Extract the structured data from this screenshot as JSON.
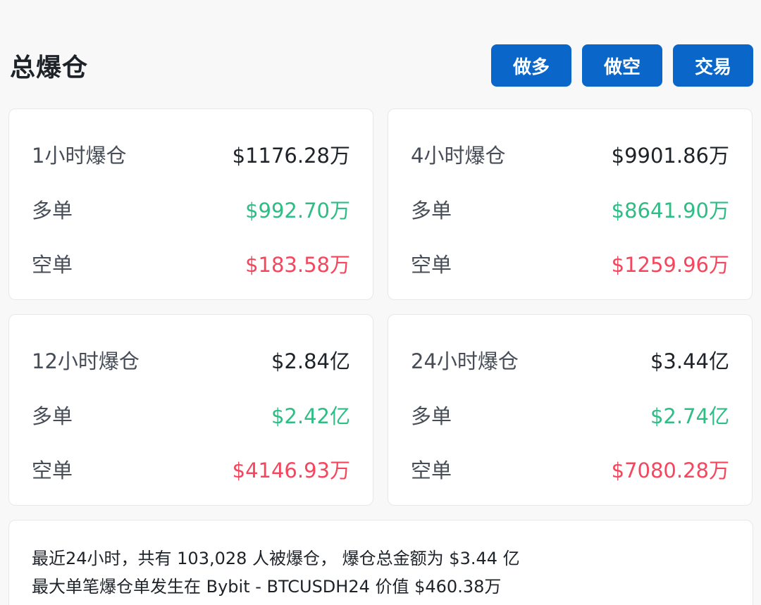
{
  "header": {
    "title": "总爆仓",
    "buttons": {
      "long": "做多",
      "short": "做空",
      "trade": "交易"
    }
  },
  "cards": [
    {
      "title": "1小时爆仓",
      "total": "$1176.28万",
      "long_label": "多单",
      "long_value": "$992.70万",
      "short_label": "空单",
      "short_value": "$183.58万"
    },
    {
      "title": "4小时爆仓",
      "total": "$9901.86万",
      "long_label": "多单",
      "long_value": "$8641.90万",
      "short_label": "空单",
      "short_value": "$1259.96万"
    },
    {
      "title": "12小时爆仓",
      "total": "$2.84亿",
      "long_label": "多单",
      "long_value": "$2.42亿",
      "short_label": "空单",
      "short_value": "$4146.93万"
    },
    {
      "title": "24小时爆仓",
      "total": "$3.44亿",
      "long_label": "多单",
      "long_value": "$2.74亿",
      "short_label": "空单",
      "short_value": "$7080.28万"
    }
  ],
  "summary": {
    "line1": "最近24小时，共有 103,028 人被爆仓， 爆仓总金额为 $3.44 亿",
    "line2": "最大单笔爆仓单发生在 Bybit - BTCUSDH24 价值 $460.38万"
  },
  "colors": {
    "accent": "#0a66c8",
    "long": "#2ebd85",
    "short": "#f6465d"
  }
}
